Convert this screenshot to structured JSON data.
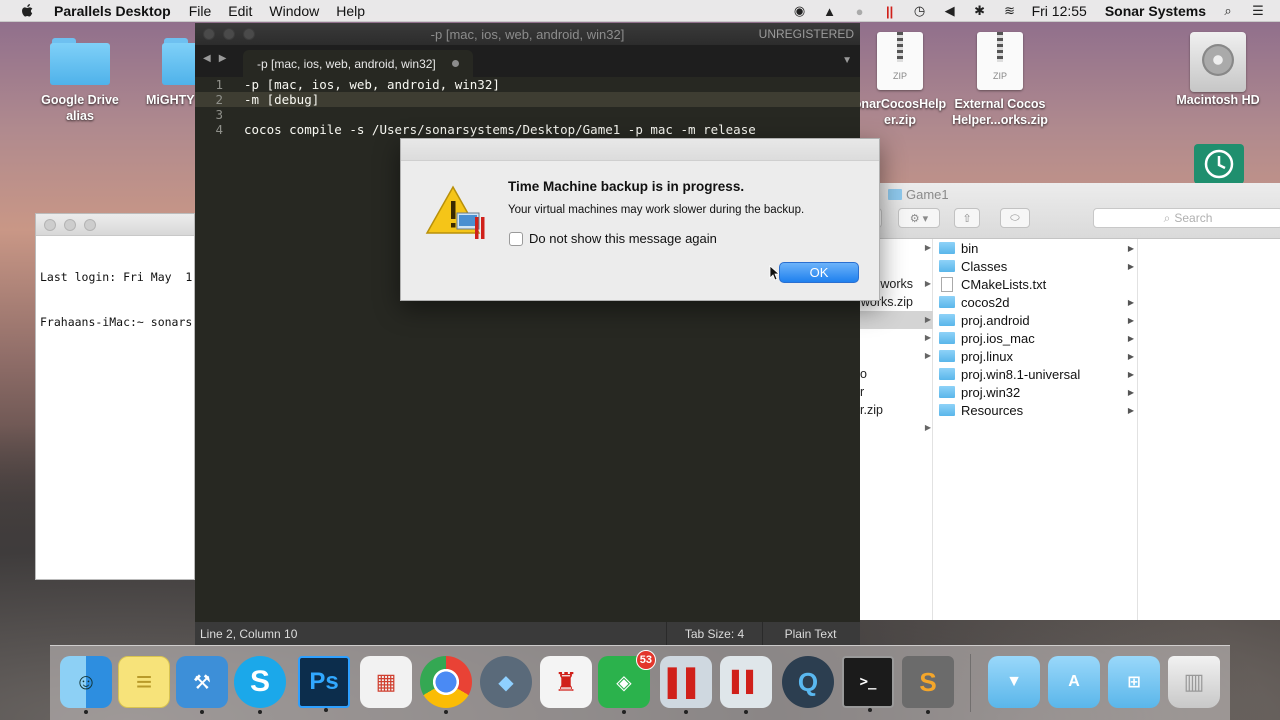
{
  "menubar": {
    "app_name": "Parallels Desktop",
    "items": [
      "File",
      "Edit",
      "Window",
      "Help"
    ],
    "clock": "Fri 12:55",
    "user": "Sonar Systems"
  },
  "desktop": {
    "icons": [
      {
        "label": "Google Drive alias",
        "icon": "folder-icon"
      },
      {
        "label": "MiGHTY",
        "icon": "folder-icon"
      },
      {
        "label": "onarCocosHelp er.zip",
        "icon": "zip-icon"
      },
      {
        "label": "External Cocos Helper...orks.zip",
        "icon": "zip-icon"
      },
      {
        "label": "Macintosh HD",
        "icon": "hard-drive-icon"
      }
    ],
    "zip_label": "ZIP"
  },
  "terminal": {
    "lines": [
      "Last login: Fri May  1",
      "Frahaans-iMac:~ sonars"
    ]
  },
  "editor": {
    "window_title": "-p [mac, ios, web, android, win32]",
    "registration": "UNREGISTERED",
    "tab_label": "-p [mac, ios, web, android, win32]",
    "lines": [
      {
        "number": "1",
        "text": "-p [mac, ios, web, android, win32]"
      },
      {
        "number": "2",
        "text": "-m [debug]"
      },
      {
        "number": "3",
        "text": ""
      },
      {
        "number": "4",
        "text": "cocos compile -s /Users/sonarsystems/Desktop/Game1 -p mac -m release"
      }
    ],
    "status": {
      "position": "Line 2, Column 10",
      "tab_size": "Tab Size: 4",
      "syntax": "Plain Text"
    }
  },
  "finder": {
    "title": "Game1",
    "search_placeholder": "Search",
    "left_column": [
      "works",
      "works.zip",
      "",
      "",
      "",
      "o",
      "r",
      "r.zip",
      ""
    ],
    "items": [
      {
        "name": "bin",
        "type": "folder"
      },
      {
        "name": "Classes",
        "type": "folder"
      },
      {
        "name": "CMakeLists.txt",
        "type": "file"
      },
      {
        "name": "cocos2d",
        "type": "folder"
      },
      {
        "name": "proj.android",
        "type": "folder"
      },
      {
        "name": "proj.ios_mac",
        "type": "folder"
      },
      {
        "name": "proj.linux",
        "type": "folder"
      },
      {
        "name": "proj.win8.1-universal",
        "type": "folder"
      },
      {
        "name": "proj.win32",
        "type": "folder"
      },
      {
        "name": "Resources",
        "type": "folder"
      }
    ]
  },
  "dialog": {
    "heading": "Time Machine backup is in progress.",
    "message": "Your virtual machines may work slower during the backup.",
    "checkbox_label": "Do not show this message again",
    "ok_label": "OK"
  },
  "dock": {
    "items": [
      {
        "name": "finder",
        "color": "#4ea3e8"
      },
      {
        "name": "notes",
        "color": "#f7e37a"
      },
      {
        "name": "xcode",
        "color": "#3d8fd8"
      },
      {
        "name": "skype",
        "color": "#1ba8ea",
        "glyph": "S"
      },
      {
        "name": "photoshop",
        "color": "#0c2d4c",
        "glyph": "Ps"
      },
      {
        "name": "launchpad-grid",
        "color": "#f2f2f2"
      },
      {
        "name": "chrome",
        "color": "#e8e8e8"
      },
      {
        "name": "crystal-app",
        "color": "#5a6a7a"
      },
      {
        "name": "popcorn",
        "color": "#f4f4f4"
      },
      {
        "name": "feedly",
        "color": "#2bb24c",
        "badge": "53"
      },
      {
        "name": "parallels-vm",
        "color": "#cfd8e0"
      },
      {
        "name": "parallels-vm2",
        "color": "#dfe6ea"
      },
      {
        "name": "quicktime",
        "color": "#2c3e50"
      },
      {
        "name": "terminal",
        "color": "#1b1b1b",
        "glyph": ">_"
      },
      {
        "name": "sublime-text",
        "color": "#6b6b6b",
        "glyph": "S"
      },
      {
        "name": "downloads-folder",
        "color": "#7fd0f8"
      },
      {
        "name": "applications-folder",
        "color": "#7fd0f8"
      },
      {
        "name": "windows-folder",
        "color": "#7fd0f8"
      },
      {
        "name": "trash",
        "color": "#e2e2e2"
      }
    ]
  }
}
